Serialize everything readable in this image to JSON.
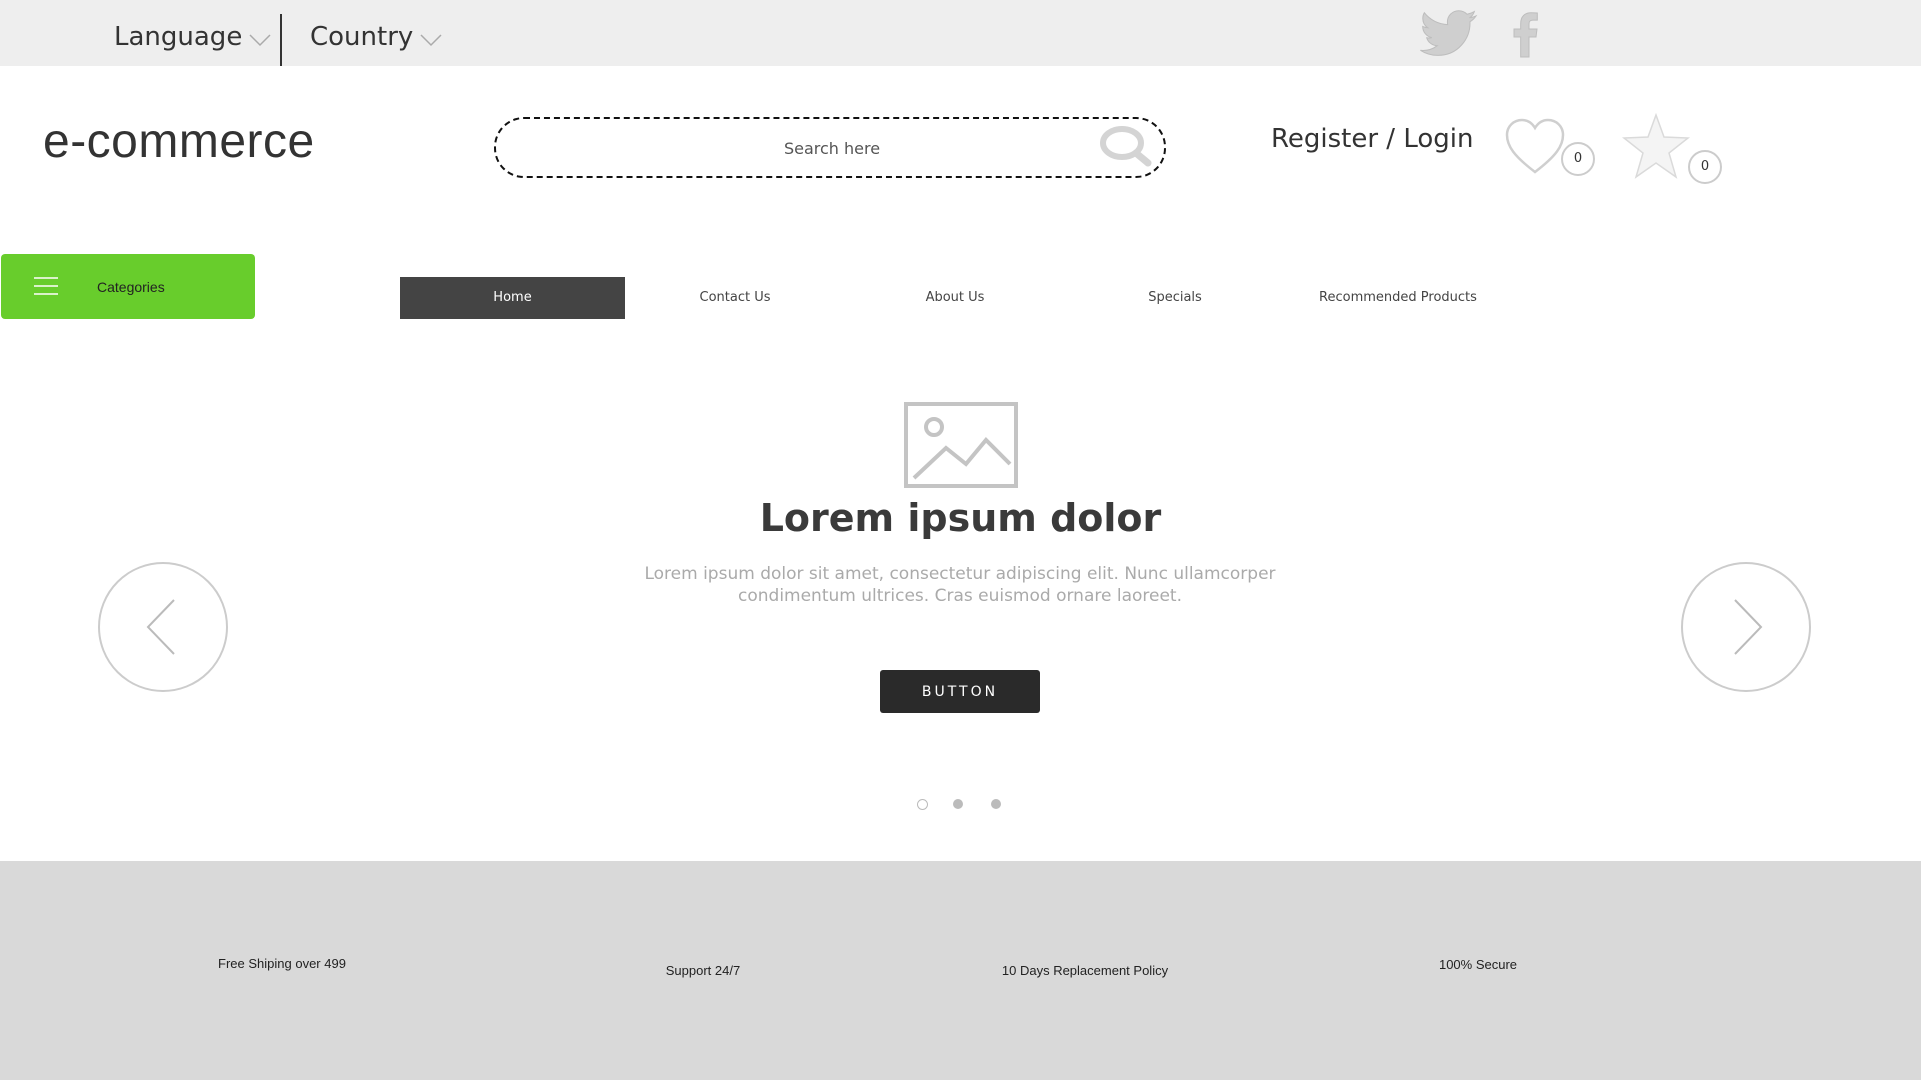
{
  "topbar": {
    "language_label": "Language",
    "country_label": "Country",
    "social": [
      "twitter-icon",
      "facebook-icon"
    ]
  },
  "header": {
    "logo": "e-commerce",
    "search": {
      "placeholder": "Search here",
      "value": ""
    },
    "auth_label": "Register / Login",
    "wishlist_count": "0",
    "favorites_count": "0"
  },
  "nav": {
    "categories_label": "Categories",
    "items": [
      {
        "label": "Home",
        "active": true
      },
      {
        "label": "Contact Us"
      },
      {
        "label": "About Us"
      },
      {
        "label": "Specials"
      },
      {
        "label": "Recommended Products"
      }
    ]
  },
  "hero": {
    "image_icon": "image-placeholder-icon",
    "title": "Lorem ipsum dolor",
    "text": "Lorem ipsum dolor sit amet, consectetur adipiscing elit. Nunc ullamcorper condimentum ultrices. Cras euismod ornare laoreet.",
    "button_label": "BUTTON",
    "slides_total": 3,
    "active_slide": 1
  },
  "footer": {
    "features": [
      "Free Shiping over 499",
      "Support 24/7",
      "10 Days Replacement Policy",
      "100% Secure"
    ]
  },
  "colors": {
    "accent_green": "#68cd2c",
    "nav_active": "#444444",
    "button_dark": "#2a2a2a",
    "topbar_bg": "#eeeeee",
    "footer_bg": "#d9d9d9"
  }
}
